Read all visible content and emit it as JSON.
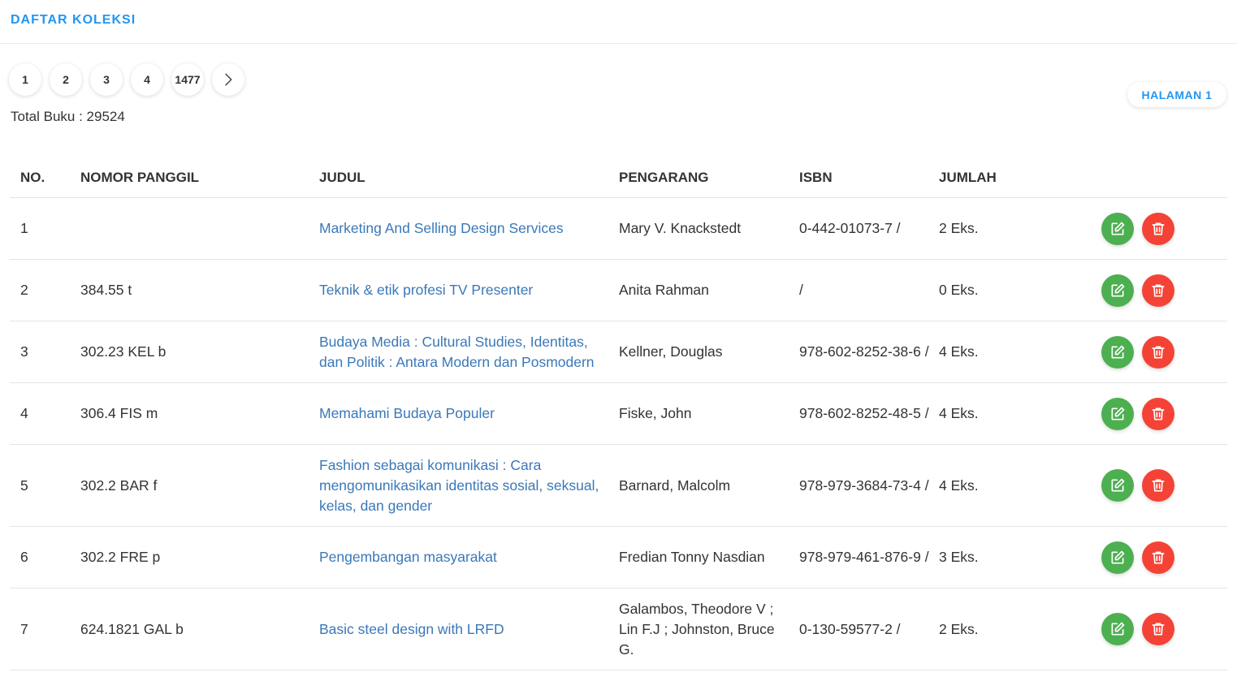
{
  "header": {
    "title": "DAFTAR KOLEKSI"
  },
  "pagination": {
    "pages": [
      "1",
      "2",
      "3",
      "4",
      "1477"
    ],
    "next_icon": "chevron-right-icon"
  },
  "total_label": "Total Buku : 29524",
  "page_badge": "HALAMAN 1",
  "table": {
    "headers": [
      "NO.",
      "NOMOR PANGGIL",
      "JUDUL",
      "PENGARANG",
      "ISBN",
      "JUMLAH"
    ],
    "rows": [
      {
        "no": "1",
        "nomor_panggil": "",
        "judul": "Marketing And Selling Design Services",
        "pengarang": "Mary V. Knackstedt",
        "isbn": "0-442-01073-7 /",
        "jumlah": "2 Eks."
      },
      {
        "no": "2",
        "nomor_panggil": "384.55 t",
        "judul": "Teknik & etik profesi TV Presenter",
        "pengarang": "Anita Rahman",
        "isbn": "/",
        "jumlah": "0 Eks."
      },
      {
        "no": "3",
        "nomor_panggil": "302.23 KEL b",
        "judul": "Budaya Media : Cultural Studies, Identitas, dan Politik : Antara Modern dan Posmodern",
        "pengarang": "Kellner, Douglas",
        "isbn": "978-602-8252-38-6 /",
        "jumlah": "4 Eks."
      },
      {
        "no": "4",
        "nomor_panggil": "306.4 FIS m",
        "judul": "Memahami Budaya Populer",
        "pengarang": "Fiske, John",
        "isbn": "978-602-8252-48-5 /",
        "jumlah": "4 Eks."
      },
      {
        "no": "5",
        "nomor_panggil": "302.2 BAR f",
        "judul": "Fashion sebagai komunikasi : Cara mengomunikasikan identitas sosial, seksual, kelas, dan gender",
        "pengarang": "Barnard, Malcolm",
        "isbn": "978-979-3684-73-4 /",
        "jumlah": "4 Eks."
      },
      {
        "no": "6",
        "nomor_panggil": "302.2 FRE p",
        "judul": "Pengembangan masyarakat",
        "pengarang": "Fredian Tonny Nasdian",
        "isbn": "978-979-461-876-9 /",
        "jumlah": "3 Eks."
      },
      {
        "no": "7",
        "nomor_panggil": "624.1821 GAL b",
        "judul": "Basic steel design with LRFD",
        "pengarang": "Galambos, Theodore V ; Lin F.J ; Johnston, Bruce G.",
        "isbn": "0-130-59577-2 /",
        "jumlah": "2 Eks."
      }
    ],
    "row_actions": {
      "edit_icon": "edit-icon",
      "delete_icon": "trash-icon"
    }
  },
  "colors": {
    "accent": "#2196f3",
    "link": "#3a78b8",
    "edit": "#4caf50",
    "delete": "#f44336"
  }
}
